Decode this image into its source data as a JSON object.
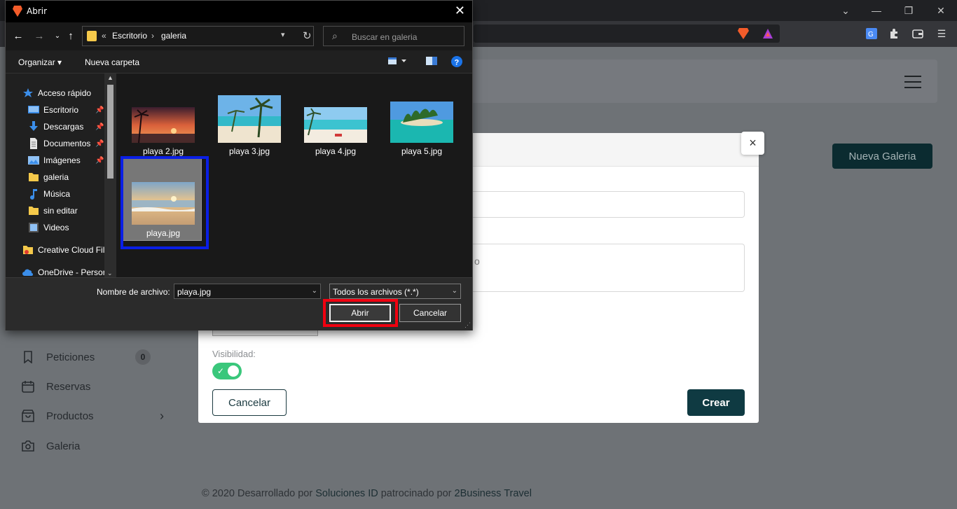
{
  "dialog": {
    "title": "Abrir",
    "address": {
      "overflow_glyph": "«",
      "crumbs": [
        "Escritorio",
        "galeria"
      ],
      "separator": "›"
    },
    "search_placeholder": "Buscar en galeria",
    "commands": {
      "organize": "Organizar",
      "new_folder": "Nueva carpeta"
    },
    "nav_items": [
      {
        "label": "Acceso rápido",
        "icon": "star-icon"
      },
      {
        "label": "Escritorio",
        "icon": "desktop-folder-icon",
        "pinned": true
      },
      {
        "label": "Descargas",
        "icon": "download-folder-icon",
        "pinned": true
      },
      {
        "label": "Documentos",
        "icon": "documents-folder-icon",
        "pinned": true
      },
      {
        "label": "Imágenes",
        "icon": "pictures-folder-icon",
        "pinned": true
      },
      {
        "label": "galeria",
        "icon": "folder-icon"
      },
      {
        "label": "Música",
        "icon": "music-folder-icon"
      },
      {
        "label": "sin editar",
        "icon": "folder-icon"
      },
      {
        "label": "Videos",
        "icon": "videos-folder-icon"
      },
      {
        "label": "Creative Cloud Fil",
        "icon": "creative-cloud-icon"
      },
      {
        "label": "OneDrive - Persor",
        "icon": "onedrive-icon"
      }
    ],
    "files": [
      {
        "name": "playa 2.jpg",
        "selected": false
      },
      {
        "name": "playa 3.jpg",
        "selected": false
      },
      {
        "name": "playa 4.jpg",
        "selected": false
      },
      {
        "name": "playa 5.jpg",
        "selected": false
      },
      {
        "name": "playa.jpg",
        "selected": true
      }
    ],
    "filename_label": "Nombre de archivo:",
    "filename_value": "playa.jpg",
    "filetype_value": "Todos los archivos (*.*)",
    "open_button": "Abrir",
    "cancel_button": "Cancelar"
  },
  "app": {
    "new_gallery_button": "Nueva Galeria",
    "sidebar": [
      {
        "label": "Peticiones",
        "icon": "bookmark-icon",
        "badge": "0"
      },
      {
        "label": "Reservas",
        "icon": "calendar-icon"
      },
      {
        "label": "Productos",
        "icon": "shopping-bag-icon",
        "chevron": "›"
      },
      {
        "label": "Galeria",
        "icon": "camera-icon"
      }
    ],
    "footer": {
      "prefix": "© 2020 Desarrollado por",
      "link1": "Soluciones ID",
      "middle": "patrocinado por",
      "link2": "2Business Travel"
    }
  },
  "modal": {
    "close_glyph": "×",
    "description_placeholder_fragment": "o",
    "visibility_label": "Visibilidad:",
    "visibility_on": true,
    "cancel_button": "Cancelar",
    "create_button": "Crear"
  },
  "colors": {
    "brand_dark": "#0f3a42",
    "toggle_green": "#3ac77b",
    "highlight_blue": "#0a1fe6",
    "highlight_red": "#f0000f"
  }
}
